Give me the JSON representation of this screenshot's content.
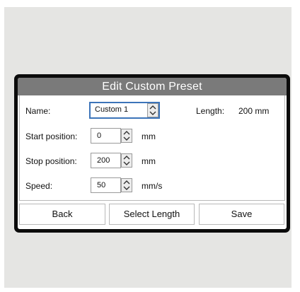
{
  "dialog": {
    "title": "Edit Custom Preset"
  },
  "form": {
    "name_label": "Name:",
    "name_value": "Custom 1",
    "length_label": "Length:",
    "length_value": "200 mm",
    "start_label": "Start position:",
    "start_value": "0",
    "start_unit": "mm",
    "stop_label": "Stop position:",
    "stop_value": "200",
    "stop_unit": "mm",
    "speed_label": "Speed:",
    "speed_value": "50",
    "speed_unit": "mm/s"
  },
  "footer": {
    "back_label": "Back",
    "select_length_label": "Select Length",
    "save_label": "Save"
  },
  "colors": {
    "title_bar": "#7a7a7a",
    "focus_border": "#3c74b9",
    "device_frame": "#0b0b0b"
  },
  "icons": {
    "stepper": "up-down-chevron-icon"
  }
}
